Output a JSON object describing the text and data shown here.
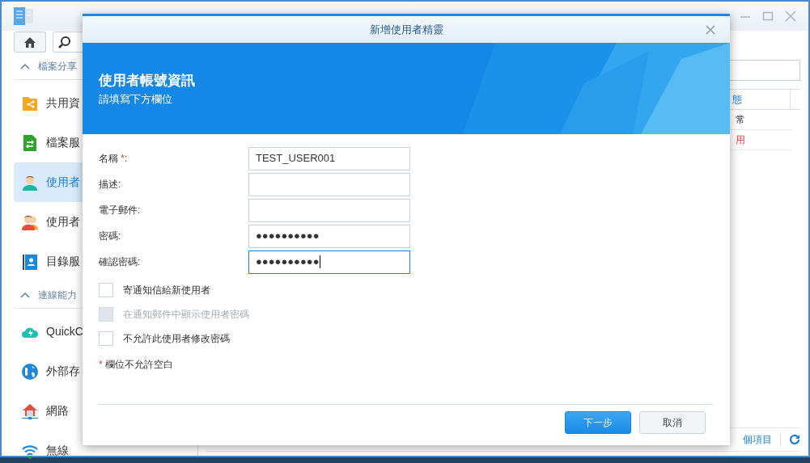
{
  "window": {
    "sidebar": [
      {
        "title": "檔案分享",
        "expanded": true,
        "items": [
          {
            "label": "共用資",
            "kind": "share-folder",
            "selected": false
          },
          {
            "label": "檔案服",
            "kind": "file-transfer",
            "selected": false
          },
          {
            "label": "使用者",
            "kind": "user",
            "selected": true
          },
          {
            "label": "使用者",
            "kind": "group",
            "selected": false
          },
          {
            "label": "目錄服",
            "kind": "directory",
            "selected": false
          }
        ]
      },
      {
        "title": "連線能力",
        "expanded": true,
        "items": [
          {
            "label": "QuickC",
            "kind": "cloud",
            "selected": false
          },
          {
            "label": "外部存",
            "kind": "globe",
            "selected": false
          },
          {
            "label": "網路",
            "kind": "house",
            "selected": false
          },
          {
            "label": "無線",
            "kind": "wifi",
            "selected": false
          }
        ]
      }
    ],
    "table": {
      "column": "態",
      "rows": [
        {
          "status": "常",
          "kind": "normal"
        },
        {
          "status": "用",
          "kind": "disabled"
        }
      ]
    },
    "footer": "個項目"
  },
  "dialog": {
    "title": "新增使用者精靈",
    "heading": "使用者帳號資訊",
    "subheading": "請填寫下方欄位",
    "fields": [
      {
        "label": "名稱",
        "required_mark": "*",
        "label_end": ":",
        "value": "TEST_USER001",
        "focused": false
      },
      {
        "label": "描述:",
        "focused": false
      },
      {
        "label": "電子郵件:",
        "focused": false
      },
      {
        "label": "密碼:",
        "value": "●●●●●●●●●●",
        "focused": false
      },
      {
        "label": "確認密碼:",
        "value": "●●●●●●●●●●",
        "focused": true
      }
    ],
    "checkboxes": [
      {
        "label": "寄通知信給新使用者",
        "checked": false,
        "disabled": false
      },
      {
        "label": "在通知郵件中顯示使用者密碼",
        "checked": false,
        "disabled": true
      },
      {
        "label": "不允許此使用者修改密碼",
        "checked": false,
        "disabled": false
      }
    ],
    "note": {
      "mark": "*",
      "text": "欄位不允許空白"
    },
    "buttons": [
      {
        "label": "下一步",
        "kind": "primary"
      },
      {
        "label": "取消",
        "kind": "secondary"
      }
    ]
  }
}
